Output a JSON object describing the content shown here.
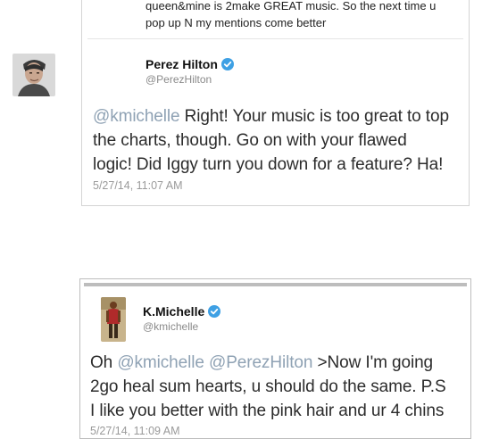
{
  "tweet_prev": {
    "text_line1": "queen&mine is 2make GREAT music. So the next time u",
    "text_line2": "pop up N my mentions come better"
  },
  "tweet1": {
    "name": "Perez Hilton",
    "handle": "@PerezHilton",
    "mention": "@kmichelle",
    "line1_rest": "Right! Your music is too great to top",
    "line2": "the charts, though. Go on with your flawed",
    "line3": "logic! Did Iggy turn you down for a feature? Ha!",
    "date": "5/27/14, 11:07 AM"
  },
  "tweet2": {
    "name": "K.Michelle",
    "handle": "@kmichelle",
    "line1_start": "Oh",
    "mention1": "@kmichelle",
    "mention2": "@PerezHilton",
    "line1_rest": ">Now I'm going",
    "line2": "2go heal sum hearts, u should do the same. P.S",
    "line3": "I like you better with the pink hair and ur 4 chins",
    "date": "5/27/14, 11:09 AM"
  },
  "colors": {
    "mention": "#8fa2b4",
    "verified": "#3ea0e4"
  }
}
